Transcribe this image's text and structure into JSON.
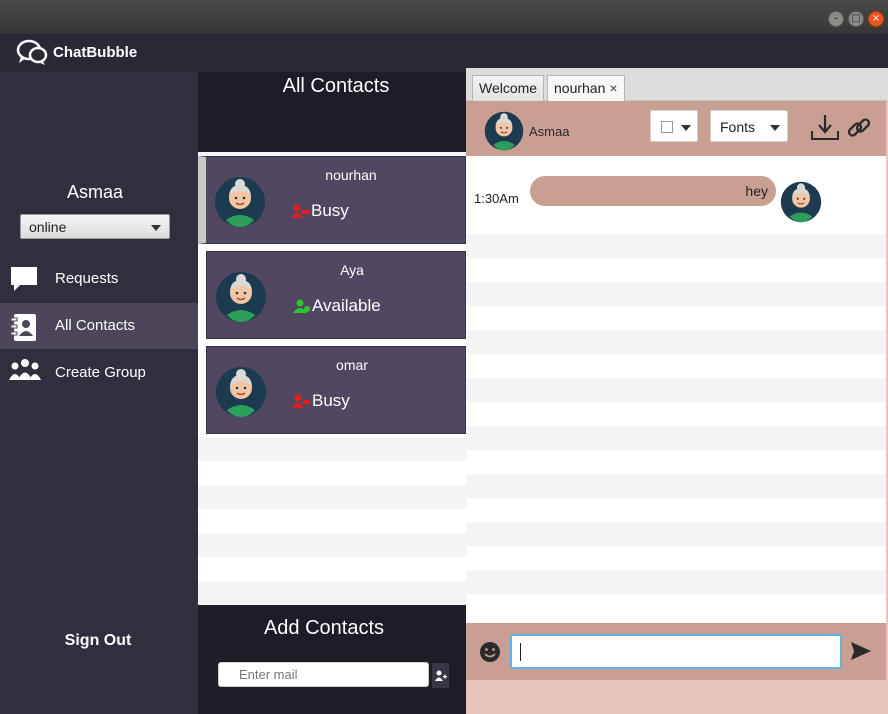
{
  "app": {
    "name": "ChatBubble"
  },
  "window_controls": {
    "minimize": "–",
    "maximize": "□",
    "close": "×"
  },
  "sidebar": {
    "username": "Asmaa",
    "status_selected": "online",
    "nav": [
      {
        "label": "Requests",
        "icon": "speech-bubble-icon"
      },
      {
        "label": "All Contacts",
        "icon": "address-book-icon",
        "active": true
      },
      {
        "label": "Create Group",
        "icon": "group-icon"
      }
    ],
    "sign_out": "Sign Out"
  },
  "contacts": {
    "title": "All Contacts",
    "items": [
      {
        "name": "nourhan",
        "status": "Busy",
        "status_color": "#e02020",
        "selected": true
      },
      {
        "name": "Aya",
        "status": "Available",
        "status_color": "#2ec52e"
      },
      {
        "name": "omar",
        "status": "Busy",
        "status_color": "#e02020"
      }
    ],
    "add_title": "Add Contacts",
    "mail_placeholder": "Enter mail"
  },
  "chat": {
    "tabs": [
      {
        "label": "Welcome"
      },
      {
        "label": "nourhan",
        "closable": true,
        "active": true
      }
    ],
    "tab_close": "×",
    "header_name": "Asmaa",
    "fonts_label": "Fonts",
    "messages": [
      {
        "time": "1:30Am",
        "text": "hey"
      }
    ],
    "input_value": ""
  },
  "colors": {
    "sidebar": "#332e3e",
    "contact_card": "#514760",
    "chat_accent": "#c99f93",
    "busy": "#e02020",
    "available": "#2ec52e"
  }
}
